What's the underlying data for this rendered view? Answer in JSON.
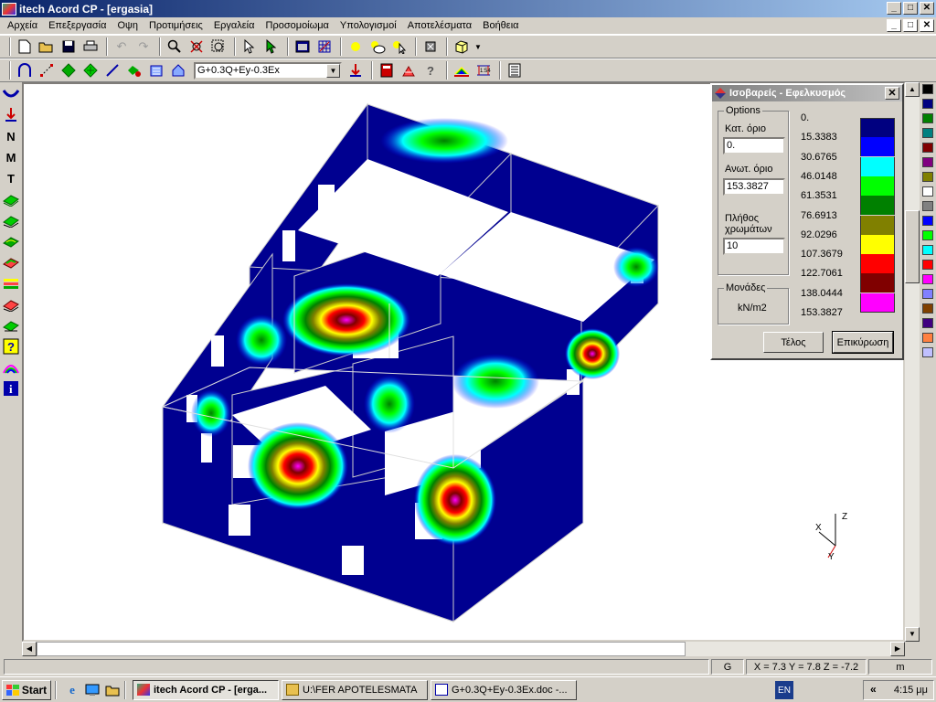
{
  "window": {
    "title": "itech Acord CP - [ergasia]",
    "min": "_",
    "max": "□",
    "close": "✕"
  },
  "menu": [
    "Αρχεία",
    "Επεξεργασία",
    "Οψη",
    "Προτιμήσεις",
    "Εργαλεία",
    "Προσομοίωμα",
    "Υπολογισμοί",
    "Αποτελέσματα",
    "Βοήθεια"
  ],
  "toolbar2": {
    "load_combo": "G+0.3Q+Ey-0.3Ex"
  },
  "lefttoolbar": {
    "n": "N",
    "m": "M",
    "t": "T"
  },
  "dialog": {
    "title": "Ισοβαρείς - Εφελκυσμός",
    "options_group": "Options",
    "min_label": "Κατ. όριο",
    "min_value": "0.",
    "max_label": "Ανωτ. όριο",
    "max_value": "153.3827",
    "count_label_1": "Πλήθος",
    "count_label_2": "χρωμάτων",
    "count_value": "10",
    "units_group": "Μονάδες",
    "units": "kN/m2",
    "btn_end": "Τέλος",
    "btn_confirm": "Επικύρωση",
    "legend_values": [
      "0.",
      "15.3383",
      "30.6765",
      "46.0148",
      "61.3531",
      "76.6913",
      "92.0296",
      "107.3679",
      "122.7061",
      "138.0444",
      "153.3827"
    ],
    "legend_colors": [
      "#000080",
      "#0000ff",
      "#00ffff",
      "#00ff00",
      "#008000",
      "#808000",
      "#ffff00",
      "#ff0000",
      "#800000",
      "#ff00ff"
    ]
  },
  "palette": [
    "#000000",
    "#000080",
    "#008000",
    "#008080",
    "#800000",
    "#800080",
    "#808000",
    "#ffffff",
    "#808080",
    "#0000ff",
    "#00ff00",
    "#00ffff",
    "#ff0000",
    "#ff00ff",
    "#8080ff",
    "#804000",
    "#400080",
    "#ff8040",
    "#c0c0ff"
  ],
  "axes": {
    "x": "X",
    "y": "Y",
    "z": "Z"
  },
  "status": {
    "mode": "G",
    "coords": "X = 7.3  Y = 7.8  Z = -7.2",
    "unit": "m"
  },
  "taskbar": {
    "start": "Start",
    "tasks": [
      "itech Acord CP - [erga...",
      "U:\\FER APOTELESMATA",
      "G+0.3Q+Ey-0.3Ex.doc -..."
    ],
    "lang": "EN",
    "chevron": "«",
    "clock": "4:15 μμ"
  }
}
